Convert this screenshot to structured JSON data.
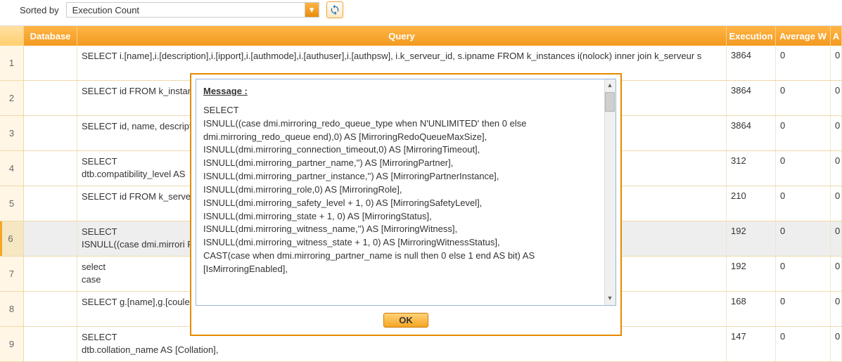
{
  "topbar": {
    "sorted_by_label": "Sorted by",
    "sort_value": "Execution Count"
  },
  "columns": {
    "database": "Database",
    "query": "Query",
    "execution": "Execution",
    "average": "Average W",
    "last": "A"
  },
  "rows": [
    {
      "n": "1",
      "query": "SELECT i.[name],i.[description],i.[ipport],i.[authmode],i.[authuser],i.[authpsw], i.k_serveur_id, s.ipname FROM k_instances i(nolock) inner join k_serveur s",
      "exec": "3864",
      "avg": "0",
      "last": "0"
    },
    {
      "n": "2",
      "query": "SELECT id FROM k_instan",
      "exec": "3864",
      "avg": "0",
      "last": "0"
    },
    {
      "n": "3",
      "query": "SELECT id, name, descript",
      "exec": "3864",
      "avg": "0",
      "last": "0"
    },
    {
      "n": "4",
      "query": "SELECT\ndtb.compatibility_level AS",
      "exec": "312",
      "avg": "0",
      "last": "0"
    },
    {
      "n": "5",
      "query": "SELECT id FROM k_serve",
      "exec": "210",
      "avg": "0",
      "last": "0"
    },
    {
      "n": "6",
      "query": "SELECT\nISNULL((case dmi.mirrori                                                                                                                                                RedoQueueMaxSize],",
      "exec": "192",
      "avg": "0",
      "last": "0",
      "selected": true
    },
    {
      "n": "7",
      "query": "select\ncase",
      "exec": "192",
      "avg": "0",
      "last": "0"
    },
    {
      "n": "8",
      "query": "SELECT g.[name],g.[coule",
      "exec": "168",
      "avg": "0",
      "last": "0"
    },
    {
      "n": "9",
      "query": "SELECT\ndtb.collation_name AS [Collation],",
      "exec": "147",
      "avg": "0",
      "last": "0"
    }
  ],
  "dialog": {
    "heading": "Message :",
    "text": "SELECT\nISNULL((case dmi.mirroring_redo_queue_type when N'UNLIMITED' then 0 else dmi.mirroring_redo_queue end),0) AS [MirroringRedoQueueMaxSize],\nISNULL(dmi.mirroring_connection_timeout,0) AS [MirroringTimeout],\nISNULL(dmi.mirroring_partner_name,'') AS [MirroringPartner],\nISNULL(dmi.mirroring_partner_instance,'') AS [MirroringPartnerInstance],\nISNULL(dmi.mirroring_role,0) AS [MirroringRole],\nISNULL(dmi.mirroring_safety_level + 1, 0) AS [MirroringSafetyLevel],\nISNULL(dmi.mirroring_state + 1, 0) AS [MirroringStatus],\nISNULL(dmi.mirroring_witness_name,'') AS [MirroringWitness],\nISNULL(dmi.mirroring_witness_state + 1, 0) AS [MirroringWitnessStatus],\nCAST(case when dmi.mirroring_partner_name is null then 0 else 1 end AS bit) AS [IsMirroringEnabled],",
    "ok_label": "OK"
  }
}
